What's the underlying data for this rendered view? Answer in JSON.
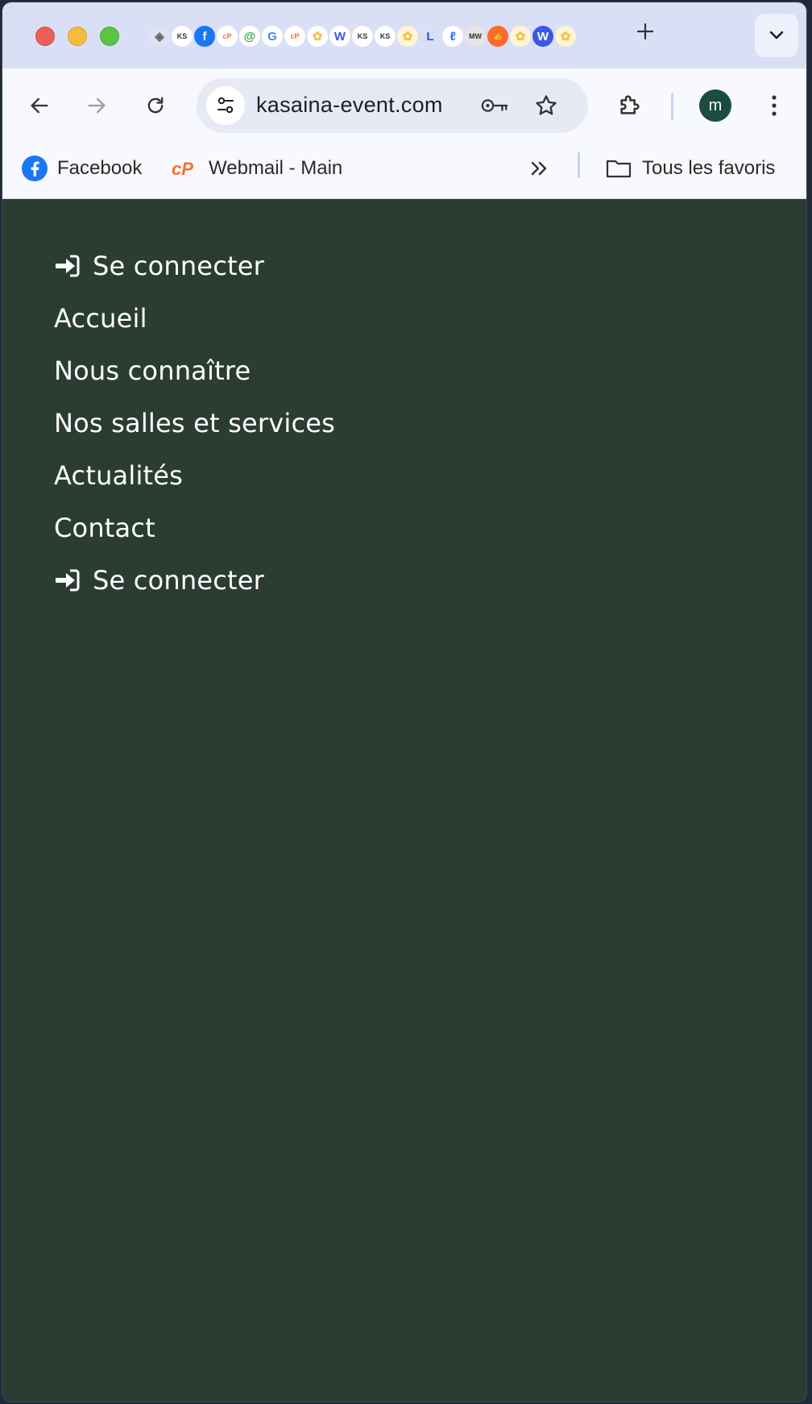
{
  "browser": {
    "tabs_favicons": [
      {
        "name": "kasaina-diamond-favicon",
        "glyph": "◈",
        "bg": "#dfe3f2",
        "fg": "#666666"
      },
      {
        "name": "ks-favicon",
        "glyph": "KS",
        "bg": "#ffffff",
        "fg": "#333333"
      },
      {
        "name": "facebook-favicon",
        "glyph": "f",
        "bg": "#1877f2",
        "fg": "#ffffff"
      },
      {
        "name": "cpanel-favicon",
        "glyph": "cP",
        "bg": "#ffffff",
        "fg": "#ff6c2c"
      },
      {
        "name": "at-mail-favicon",
        "glyph": "@",
        "bg": "#ffffff",
        "fg": "#34a853"
      },
      {
        "name": "google-favicon",
        "glyph": "G",
        "bg": "#ffffff",
        "fg": "#4285f4"
      },
      {
        "name": "cpanel-favicon-2",
        "glyph": "cP",
        "bg": "#ffffff",
        "fg": "#ff6c2c"
      },
      {
        "name": "flower-favicon",
        "glyph": "✿",
        "bg": "#ffffff",
        "fg": "#f2c14e"
      },
      {
        "name": "wordpress-favicon",
        "glyph": "W",
        "bg": "#ffffff",
        "fg": "#3858e9"
      },
      {
        "name": "ks-favicon-2",
        "glyph": "KS",
        "bg": "#ffffff",
        "fg": "#333333"
      },
      {
        "name": "ks-favicon-3",
        "glyph": "KS",
        "bg": "#ffffff",
        "fg": "#333333"
      },
      {
        "name": "flower-favicon-2",
        "glyph": "✿",
        "bg": "#fff4d6",
        "fg": "#f2c14e"
      },
      {
        "name": "l-favicon",
        "glyph": "L",
        "bg": "#d9dff5",
        "fg": "#1a5bd6"
      },
      {
        "name": "script-favicon",
        "glyph": "ℓ",
        "bg": "#ffffff",
        "fg": "#1a73e8"
      },
      {
        "name": "mw-favicon",
        "glyph": "MW",
        "bg": "#e6e6e6",
        "fg": "#333333"
      },
      {
        "name": "thumb-favicon",
        "glyph": "👍",
        "bg": "#ff6a2b",
        "fg": "#ffffff"
      },
      {
        "name": "flower-favicon-3",
        "glyph": "✿",
        "bg": "#fff4d6",
        "fg": "#f2c14e"
      },
      {
        "name": "wordpress-favicon-2",
        "glyph": "W",
        "bg": "#3858e9",
        "fg": "#ffffff"
      },
      {
        "name": "flower-favicon-4",
        "glyph": "✿",
        "bg": "#fff4d6",
        "fg": "#f2c14e"
      }
    ],
    "url": "kasaina-event.com",
    "avatar_letter": "m",
    "bookmarks": {
      "facebook": "Facebook",
      "webmail": "Webmail - Main",
      "all_bookmarks": "Tous les favoris"
    },
    "colors": {
      "tabstrip": "#d9dff5",
      "toolbar": "#f8f9fe",
      "avatar": "#1b4d3e"
    }
  },
  "page": {
    "background": "#2b3d33",
    "menu": {
      "login_top": "Se connecter",
      "home": "Accueil",
      "about": "Nous connaître",
      "rooms": "Nos salles et services",
      "news": "Actualités",
      "contact": "Contact",
      "login_bottom": "Se connecter"
    }
  }
}
